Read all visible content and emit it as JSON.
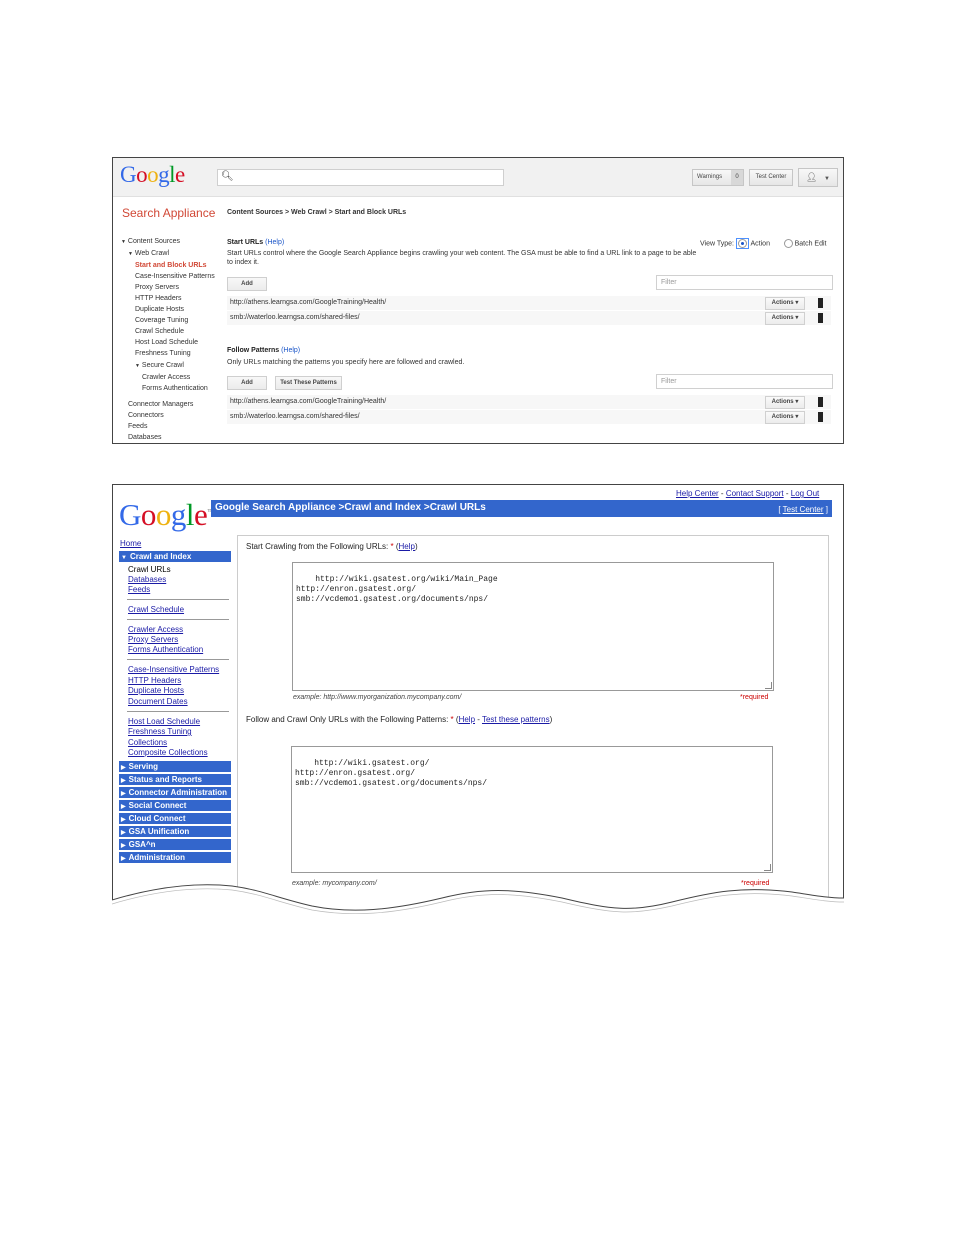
{
  "colors": {
    "google_blue": "#3366cc",
    "sa_red": "#d14836",
    "link": "#1a1aa6",
    "required_red": "#cc0000"
  },
  "shot1": {
    "logo": "Google",
    "search_icon": "search-icon",
    "warnings_label": "Warnings",
    "warnings_count": "0",
    "test_center_label": "Test Center",
    "user_menu_icon": "user-icon",
    "product_title": "Search Appliance",
    "breadcrumb": "Content Sources > Web Crawl > Start and Block URLs",
    "nav": {
      "content_sources": "Content Sources",
      "web_crawl": "Web Crawl",
      "start_block": "Start and Block URLs",
      "case_insensitive": "Case-Insensitive Patterns",
      "proxy": "Proxy Servers",
      "http_headers": "HTTP Headers",
      "duplicate_hosts": "Duplicate Hosts",
      "coverage": "Coverage Tuning",
      "crawl_schedule": "Crawl Schedule",
      "host_load": "Host Load Schedule",
      "freshness": "Freshness Tuning",
      "secure_crawl": "Secure Crawl",
      "crawler_access": "Crawler Access",
      "forms_auth": "Forms Authentication",
      "connector_managers": "Connector Managers",
      "connectors": "Connectors",
      "feeds": "Feeds",
      "databases": "Databases"
    },
    "start_urls": {
      "title": "Start URLs",
      "help": "(Help)",
      "description": "Start URLs control where the Google Search Appliance begins crawling your web content. The GSA must be able to find a URL link to a page to be able to index it.",
      "add_label": "Add",
      "filter_placeholder": "Filter",
      "rows": [
        "http://athens.learngsa.com/GoogleTraining/Health/",
        "smb://waterloo.learngsa.com/shared-files/"
      ]
    },
    "view_type": {
      "label": "View Type:",
      "action": "Action",
      "batch": "Batch Edit"
    },
    "follow_patterns": {
      "title": "Follow Patterns",
      "help": "(Help)",
      "description": "Only URLs matching the patterns you specify here are followed and crawled.",
      "add_label": "Add",
      "test_label": "Test These Patterns",
      "filter_placeholder": "Filter",
      "rows": [
        "http://athens.learngsa.com/GoogleTraining/Health/",
        "smb://waterloo.learngsa.com/shared-files/"
      ]
    },
    "actions_label": "Actions"
  },
  "shot2": {
    "top_links": {
      "help_center": "Help Center",
      "contact": "Contact Support",
      "logout": "Log Out",
      "sep": "-"
    },
    "logo": "Google",
    "bar_title": "Google Search Appliance >Crawl and Index >Crawl URLs",
    "test_center": "Test Center",
    "nav": {
      "home": "Home",
      "crawl_index": "Crawl and Index",
      "crawl_urls": "Crawl URLs",
      "databases": "Databases",
      "feeds": "Feeds",
      "crawl_schedule": "Crawl Schedule",
      "crawler_access": "Crawler Access",
      "proxy": "Proxy Servers",
      "forms_auth": "Forms Authentication",
      "case_insensitive": "Case-Insensitive Patterns",
      "http_headers": "HTTP Headers",
      "duplicate_hosts": "Duplicate Hosts",
      "document_dates": "Document Dates",
      "host_load": "Host Load Schedule",
      "freshness": "Freshness Tuning",
      "collections": "Collections",
      "composite": "Composite Collections",
      "sections": [
        "Serving",
        "Status and Reports",
        "Connector Administration",
        "Social Connect",
        "Cloud Connect",
        "GSA Unification",
        "GSA^n",
        "Administration"
      ]
    },
    "start_label": "Start Crawling from the Following URLs:",
    "required_star": "*",
    "help": "Help",
    "start_urls": "http://wiki.gsatest.org/wiki/Main_Page\nhttp://enron.gsatest.org/\nsmb://vcdemo1.gsatest.org/documents/nps/",
    "start_example": "example: http://www.myorganization.mycompany.com/",
    "required": "*required",
    "follow_label": "Follow and Crawl Only URLs with the Following Patterns:",
    "test_patterns": "Test these patterns",
    "follow_urls": "http://wiki.gsatest.org/\nhttp://enron.gsatest.org/\nsmb://vcdemo1.gsatest.org/documents/nps/",
    "follow_example": "example: mycompany.com/"
  }
}
